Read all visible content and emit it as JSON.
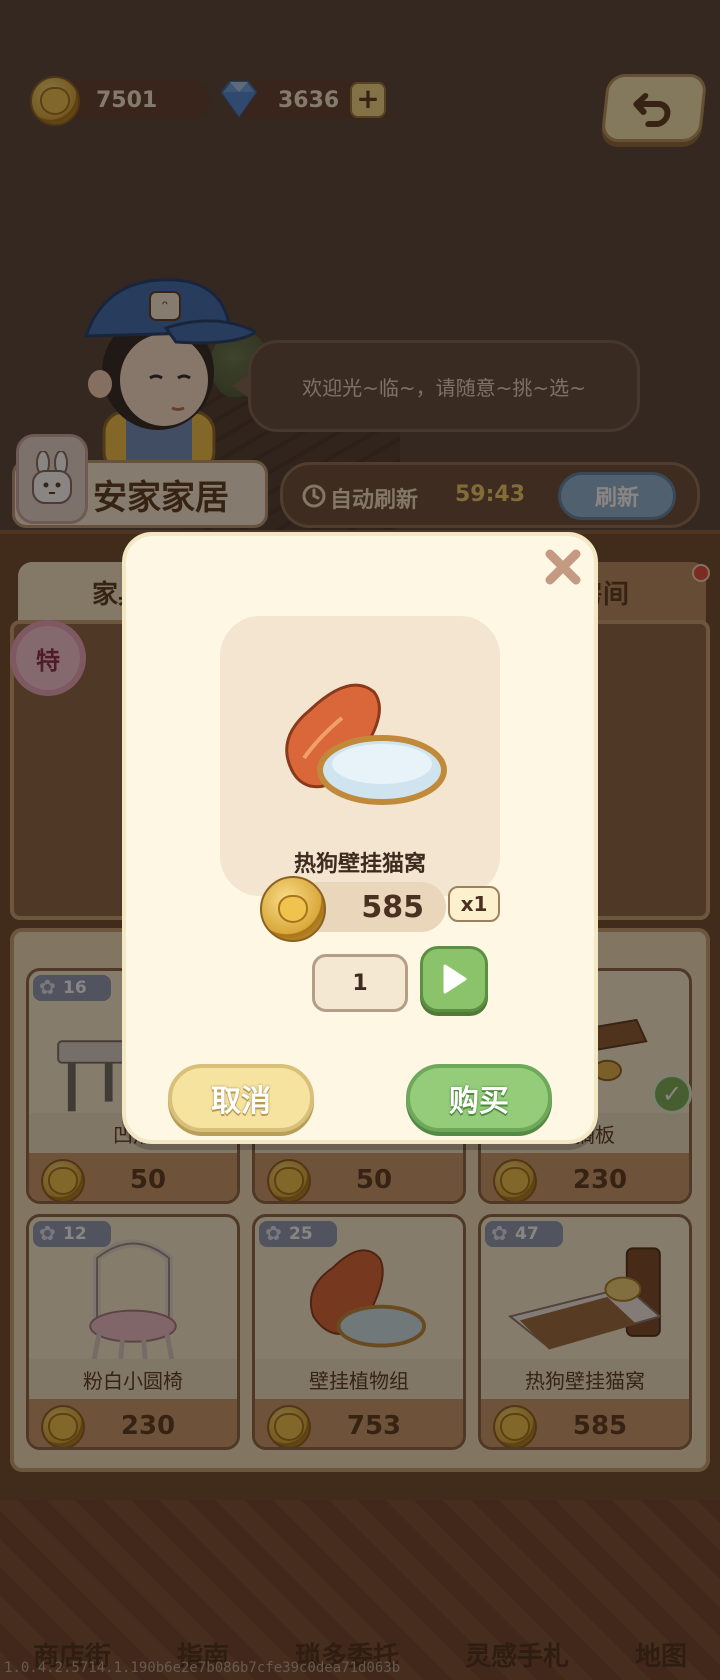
{
  "currency": {
    "coins": "7501",
    "gems": "3636",
    "coin_icon": "cat-coin-icon",
    "gem_icon": "diamond-icon",
    "plus_icon": "plus-icon"
  },
  "header": {
    "back_icon": "undo-arrow-icon"
  },
  "npc": {
    "greeting": "欢迎光~临~，请随意~挑~选~"
  },
  "shop": {
    "name": "安家家居",
    "refresh_label": "自动刷新",
    "refresh_timer": "59:43",
    "refresh_button": "刷新",
    "tabs": [
      "家具",
      "房间"
    ],
    "special_badge": "特"
  },
  "items": [
    {
      "name": "凹形",
      "price": "50",
      "favorites": "16",
      "owned": false
    },
    {
      "name": "",
      "price": "50",
      "favorites": "",
      "owned": false
    },
    {
      "name": "勾搁板",
      "price": "230",
      "favorites": "",
      "owned": true
    },
    {
      "name": "粉白小圆椅",
      "price": "230",
      "favorites": "12",
      "owned": false
    },
    {
      "name": "壁挂植物组",
      "price": "753",
      "favorites": "25",
      "owned": false
    },
    {
      "name": "热狗壁挂猫窝",
      "price": "585",
      "favorites": "47",
      "owned": false
    }
  ],
  "modal": {
    "item_name": "热狗壁挂猫窝",
    "price": "585",
    "multiplier": "x1",
    "quantity": "1",
    "cancel_label": "取消",
    "buy_label": "购买"
  },
  "bottom_nav": [
    "商店街",
    "指南",
    "琐多委托",
    "灵感手札",
    "地图"
  ],
  "version": "1.0.4.2.5714.1.190b6e2e7b086b7cfe39c0dea71d063b",
  "colors": {
    "accent_green": "#94cc7a",
    "accent_yellow": "#f6e3a0",
    "panel_brown": "#6e4a2f",
    "modal_bg": "#fdf7e4"
  }
}
